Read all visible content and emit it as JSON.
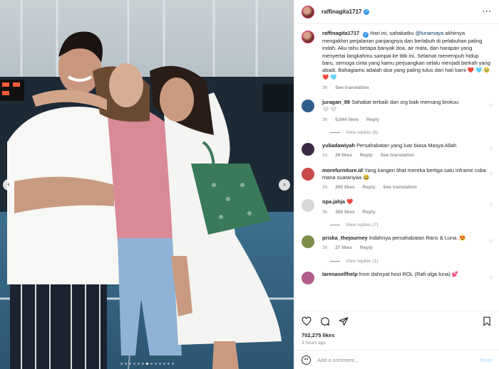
{
  "post": {
    "username": "raffinagita1717",
    "verified_mark": "✓",
    "more_icon": "more-horizontal-icon",
    "carousel": {
      "slide_count": 13,
      "active_slide": 6
    }
  },
  "caption": {
    "username": "raffinagita1717",
    "text_before": "Hari ini, sahabatku ",
    "mention": "@lunamaya",
    "text_after": " akhirnya mengakhiri perjalanan panjangnya dan berlabuh di pelabuhan paling indah. Aku tahu betapa banyak doa, air mata, dan harapan yang menyertai langkahmu sampai ke titik ini. Selamat menempuh hidup baru, semoga cinta yang kamu perjuangkan selalu menjadi berkah yang abadi. Bahagiamu adalah doa yang paling tulus dari hati kami ❤️ 🩵 🥹 ❤️ 🩵",
    "time": "3h",
    "see_translation": "See translation"
  },
  "comments": [
    {
      "username": "juragan_99",
      "text": "Sahabat terbaik dan org baik memang brokuu",
      "extra": "🤍 🤍",
      "time": "3h",
      "likes": "5,044 likes",
      "reply": "Reply",
      "translation": "",
      "view_replies": "View replies (6)",
      "avatar_color": "#2f5d8a"
    },
    {
      "username": "yuliadawiyah",
      "text": "Persahabatan yang luar biasa Masya Allah",
      "extra": "",
      "time": "1h",
      "likes": "29 likes",
      "reply": "Reply",
      "translation": "See translation",
      "view_replies": "",
      "avatar_color": "#3b2a46"
    },
    {
      "username": "morefurniture.id",
      "text": "Yang kangen lihat mereka bertiga satu inframe coba mana suaranyaa 😂",
      "extra": "",
      "time": "2h",
      "likes": "290 likes",
      "reply": "Reply",
      "translation": "See translation",
      "view_replies": "",
      "avatar_color": "#c94a4a"
    },
    {
      "username": "opa.jahja",
      "text": "❤️",
      "extra": "",
      "time": "3h",
      "likes": "350 likes",
      "reply": "Reply",
      "translation": "",
      "view_replies": "View replies (7)",
      "avatar_color": "#d8d8d8"
    },
    {
      "username": "priska_thejourney",
      "text": "Indahnya persahabatan Rans & Luna..😍",
      "extra": "",
      "time": "2h",
      "likes": "27 likes",
      "reply": "Reply",
      "translation": "",
      "view_replies": "View replies (1)",
      "avatar_color": "#7d8c4a"
    },
    {
      "username": "larenaselfhelp",
      "text": "from dahsyat host ROL (Rafi olga luna) 💕",
      "extra": "",
      "time": "",
      "likes": "",
      "reply": "",
      "translation": "",
      "view_replies": "",
      "avatar_color": "#b35b8a"
    }
  ],
  "footer": {
    "likes": "702,275 likes",
    "time_ago": "3 hours ago",
    "comment_placeholder": "Add a comment...",
    "post_label": "Post"
  },
  "icons": {
    "like": "heart-icon",
    "comment": "comment-icon",
    "share": "share-icon",
    "save": "bookmark-icon",
    "emoji": "emoji-icon",
    "prev": "chevron-left-icon",
    "next": "chevron-right-icon"
  },
  "colors": {
    "link": "#00376b",
    "verified": "#3897f0",
    "muted": "#8e8e8e",
    "post_button": "#b2dffc"
  }
}
